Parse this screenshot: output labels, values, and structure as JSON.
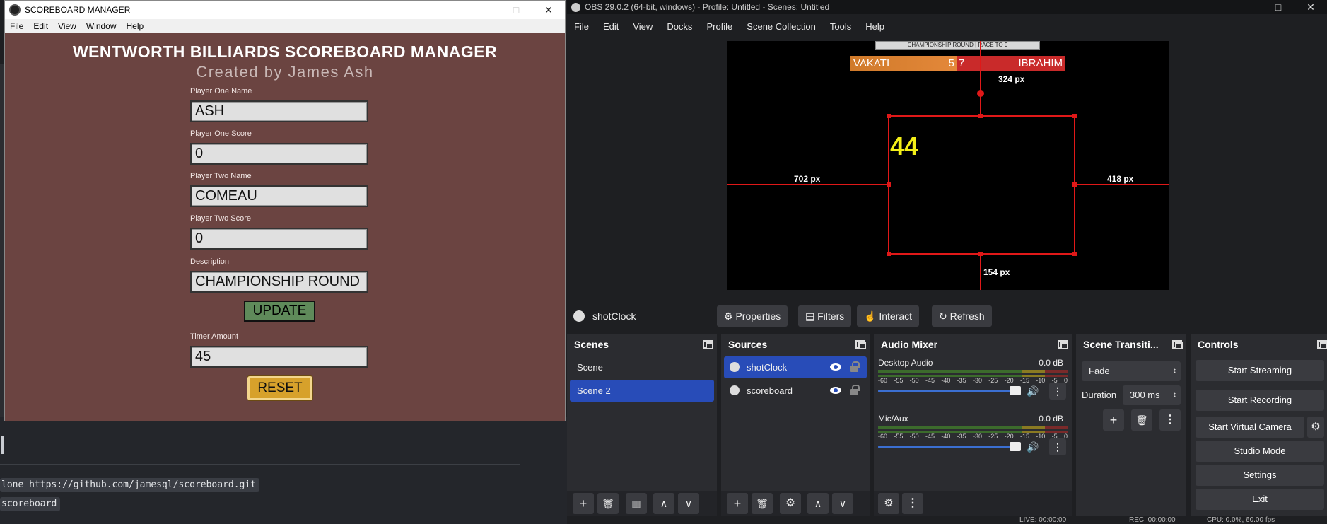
{
  "background_editor": {
    "code1": "lone https://github.com/jamesql/scoreboard.git",
    "code2": "scoreboard"
  },
  "scoreboard_manager": {
    "title": "SCOREBOARD MANAGER",
    "menu": [
      "File",
      "Edit",
      "View",
      "Window",
      "Help"
    ],
    "heading": "WENTWORTH BILLIARDS SCOREBOARD MANAGER",
    "subheading": "Created by James Ash",
    "fields": {
      "p1_name_label": "Player One Name",
      "p1_name_value": "ASH",
      "p1_score_label": "Player One Score",
      "p1_score_value": "0",
      "p2_name_label": "Player Two Name",
      "p2_name_value": "COMEAU",
      "p2_score_label": "Player Two Score",
      "p2_score_value": "0",
      "desc_label": "Description",
      "desc_value": "CHAMPIONSHIP ROUND",
      "timer_label": "Timer Amount",
      "timer_value": "45"
    },
    "update_button": "UPDATE",
    "reset_button": "RESET",
    "colors": {
      "body": "#6b4441",
      "update": "#5f8a5a",
      "reset": "#d7a12b"
    }
  },
  "obs": {
    "title": "OBS 29.0.2 (64-bit, windows) - Profile: Untitled - Scenes: Untitled",
    "menu": [
      "File",
      "Edit",
      "View",
      "Docks",
      "Profile",
      "Scene Collection",
      "Tools",
      "Help"
    ],
    "preview": {
      "banner": "CHAMPIONSHIP ROUND | RACE TO 9",
      "p1_name": "VAKATI",
      "p1_score": "5",
      "p2_score": "7",
      "p2_name": "IBRAHIM",
      "clock": "44",
      "dim_top": "324 px",
      "dim_left": "702 px",
      "dim_right": "418 px",
      "dim_bottom": "154 px"
    },
    "source_toolbar": {
      "selected_source": "shotClock",
      "properties": "Properties",
      "filters": "Filters",
      "interact": "Interact",
      "refresh": "Refresh"
    },
    "scenes": {
      "title": "Scenes",
      "items": [
        "Scene",
        "Scene 2"
      ],
      "selected": "Scene 2"
    },
    "sources": {
      "title": "Sources",
      "items": [
        "shotClock",
        "scoreboard"
      ]
    },
    "audio_mixer": {
      "title": "Audio Mixer",
      "ticks": [
        "-60",
        "-55",
        "-50",
        "-45",
        "-40",
        "-35",
        "-30",
        "-25",
        "-20",
        "-15",
        "-10",
        "-5",
        "0"
      ],
      "channels": [
        {
          "name": "Desktop Audio",
          "db": "0.0 dB"
        },
        {
          "name": "Mic/Aux",
          "db": "0.0 dB"
        }
      ]
    },
    "transitions": {
      "title": "Scene Transiti...",
      "type": "Fade",
      "duration_label": "Duration",
      "duration_value": "300 ms"
    },
    "controls": {
      "title": "Controls",
      "start_streaming": "Start Streaming",
      "start_recording": "Start Recording",
      "start_virtual_camera": "Start Virtual Camera",
      "studio_mode": "Studio Mode",
      "settings": "Settings",
      "exit": "Exit"
    },
    "status": {
      "live": "LIVE: 00:00:00",
      "rec": "REC: 00:00:00",
      "cpu": "CPU: 0.0%, 60.00 fps"
    }
  }
}
